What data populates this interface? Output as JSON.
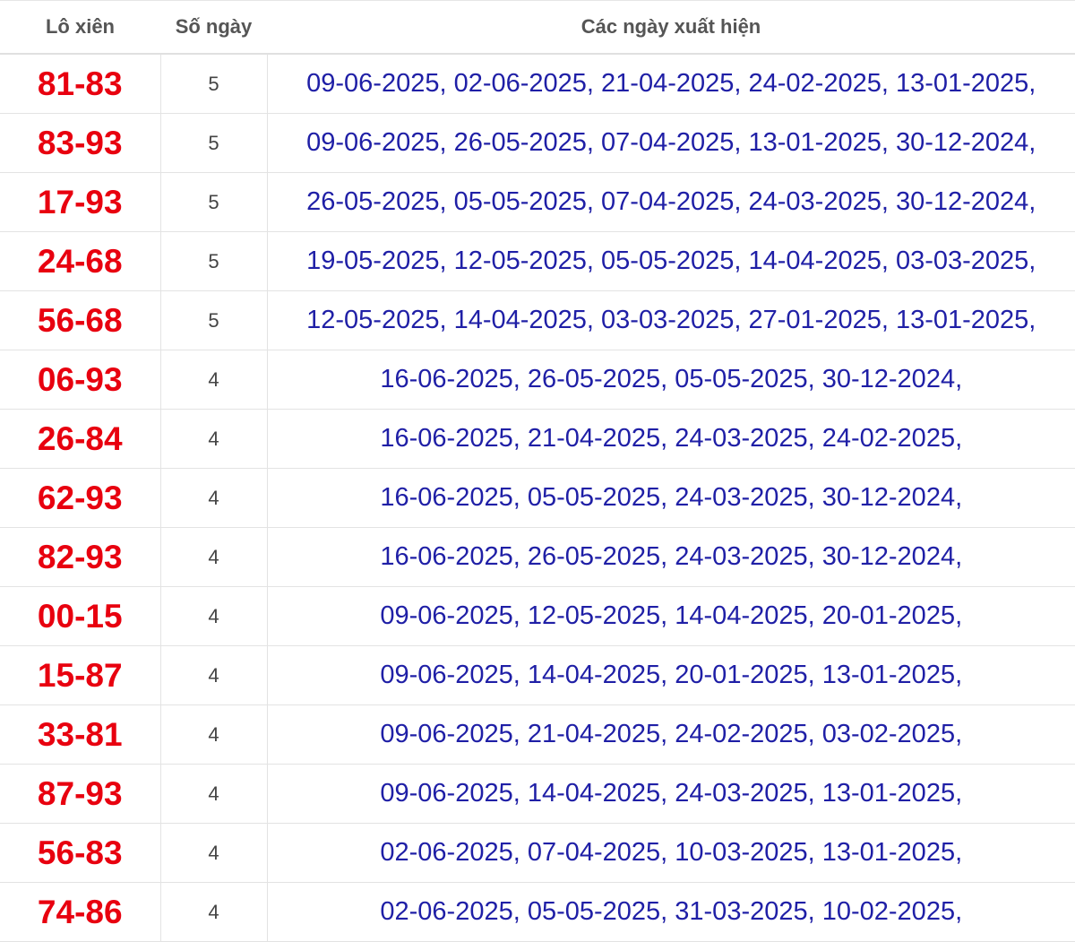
{
  "table": {
    "headers": {
      "pair": "Lô xiên",
      "count": "Số ngày",
      "dates": "Các ngày xuất hiện"
    },
    "rows": [
      {
        "pair": "81-83",
        "count": "5",
        "dates": "09-06-2025, 02-06-2025, 21-04-2025, 24-02-2025, 13-01-2025,"
      },
      {
        "pair": "83-93",
        "count": "5",
        "dates": "09-06-2025, 26-05-2025, 07-04-2025, 13-01-2025, 30-12-2024,"
      },
      {
        "pair": "17-93",
        "count": "5",
        "dates": "26-05-2025, 05-05-2025, 07-04-2025, 24-03-2025, 30-12-2024,"
      },
      {
        "pair": "24-68",
        "count": "5",
        "dates": "19-05-2025, 12-05-2025, 05-05-2025, 14-04-2025, 03-03-2025,"
      },
      {
        "pair": "56-68",
        "count": "5",
        "dates": "12-05-2025, 14-04-2025, 03-03-2025, 27-01-2025, 13-01-2025,"
      },
      {
        "pair": "06-93",
        "count": "4",
        "dates": "16-06-2025, 26-05-2025, 05-05-2025, 30-12-2024,"
      },
      {
        "pair": "26-84",
        "count": "4",
        "dates": "16-06-2025, 21-04-2025, 24-03-2025, 24-02-2025,"
      },
      {
        "pair": "62-93",
        "count": "4",
        "dates": "16-06-2025, 05-05-2025, 24-03-2025, 30-12-2024,"
      },
      {
        "pair": "82-93",
        "count": "4",
        "dates": "16-06-2025, 26-05-2025, 24-03-2025, 30-12-2024,"
      },
      {
        "pair": "00-15",
        "count": "4",
        "dates": "09-06-2025, 12-05-2025, 14-04-2025, 20-01-2025,"
      },
      {
        "pair": "15-87",
        "count": "4",
        "dates": "09-06-2025, 14-04-2025, 20-01-2025, 13-01-2025,"
      },
      {
        "pair": "33-81",
        "count": "4",
        "dates": "09-06-2025, 21-04-2025, 24-02-2025, 03-02-2025,"
      },
      {
        "pair": "87-93",
        "count": "4",
        "dates": "09-06-2025, 14-04-2025, 24-03-2025, 13-01-2025,"
      },
      {
        "pair": "56-83",
        "count": "4",
        "dates": "02-06-2025, 07-04-2025, 10-03-2025, 13-01-2025,"
      },
      {
        "pair": "74-86",
        "count": "4",
        "dates": "02-06-2025, 05-05-2025, 31-03-2025, 10-02-2025,"
      }
    ]
  }
}
